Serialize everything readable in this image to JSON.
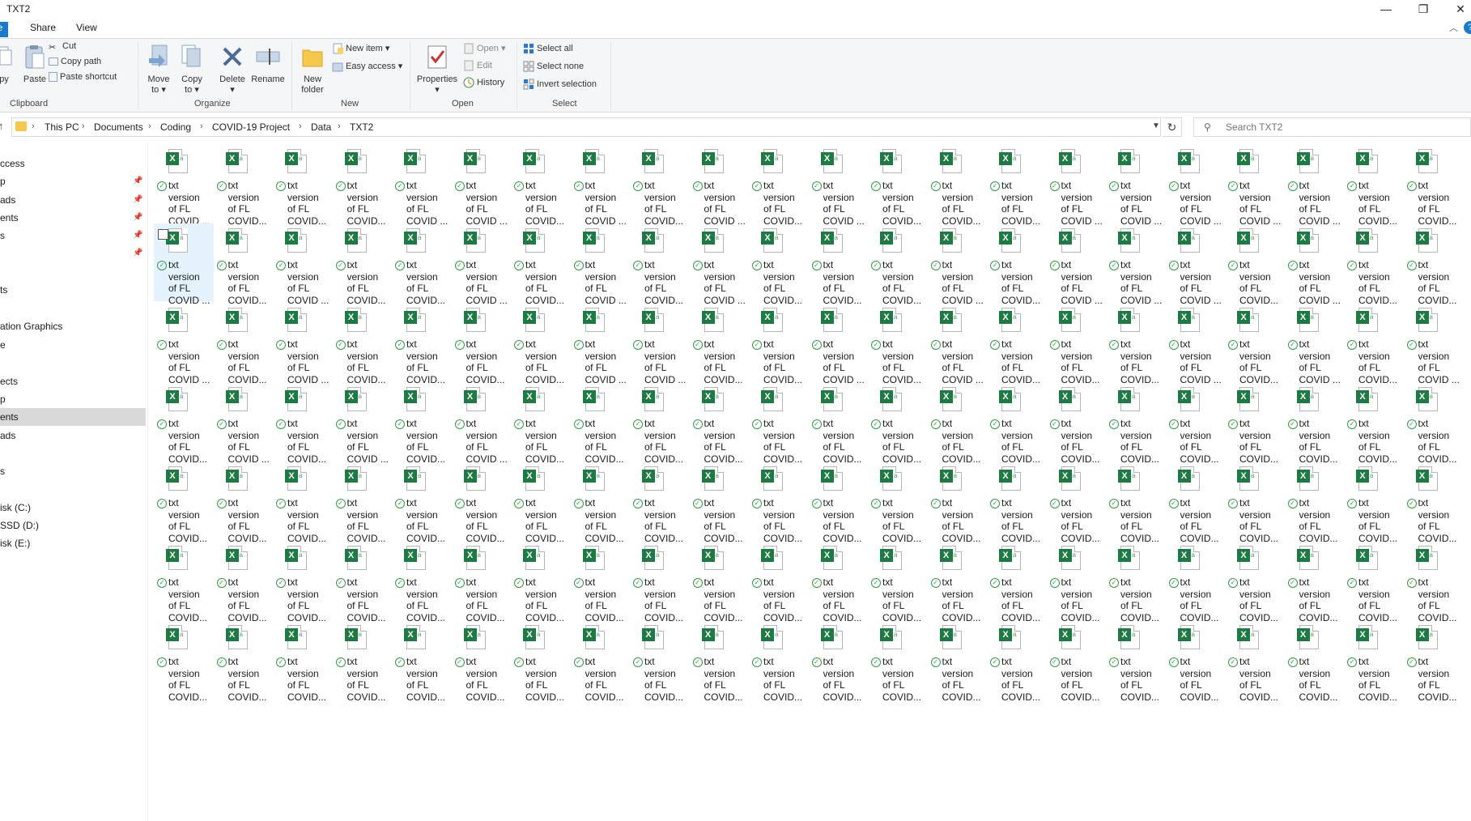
{
  "window": {
    "title": "TXT2",
    "min_glyph": "—",
    "max_glyph": "❐",
    "close_glyph": "✕"
  },
  "menu_tabs": {
    "file": "le",
    "share": "Share",
    "view": "View"
  },
  "ribbon": {
    "groups": {
      "clipboard": "Clipboard",
      "organize": "Organize",
      "new": "New",
      "open": "Open",
      "select": "Select"
    },
    "copy": "py",
    "paste": "Paste",
    "cut": "Cut",
    "copy_path": "Copy path",
    "paste_shortcut": "Paste shortcut",
    "move_to": [
      "Move",
      "to ▾"
    ],
    "copy_to": [
      "Copy",
      "to ▾"
    ],
    "delete": [
      "Delete",
      "▾"
    ],
    "rename": "Rename",
    "new_folder": [
      "New",
      "folder"
    ],
    "new_item": "New item ▾",
    "easy_access": "Easy access ▾",
    "properties": [
      "Properties",
      "▾"
    ],
    "open": "Open ▾",
    "edit": "Edit",
    "history": "History",
    "select_all": "Select all",
    "select_none": "Select none",
    "invert_selection": "Invert selection"
  },
  "address": {
    "crumbs": [
      "This PC",
      "Documents",
      "Coding",
      "COVID-19 Project",
      "Data",
      "TXT2"
    ],
    "sep": "›",
    "search_placeholder": "Search TXT2"
  },
  "nav": {
    "items": [
      {
        "label": "ccess",
        "pinned": false
      },
      {
        "label": "p",
        "pinned": true
      },
      {
        "label": "ads",
        "pinned": true
      },
      {
        "label": "ents",
        "pinned": true
      },
      {
        "label": "s",
        "pinned": true
      },
      {
        "label": "",
        "pinned": true
      },
      {
        "label": "",
        "pinned": false
      },
      {
        "label": "ts",
        "pinned": false
      },
      {
        "label": "",
        "pinned": false
      },
      {
        "label": "ation Graphics",
        "pinned": false
      },
      {
        "label": "e",
        "pinned": false
      },
      {
        "label": "",
        "pinned": false
      },
      {
        "label": "ects",
        "pinned": false
      },
      {
        "label": "p",
        "pinned": false
      },
      {
        "label": "ents",
        "pinned": false,
        "selected": true
      },
      {
        "label": "ads",
        "pinned": false
      },
      {
        "label": "",
        "pinned": false
      },
      {
        "label": "s",
        "pinned": false
      },
      {
        "label": "",
        "pinned": false
      },
      {
        "label": "isk (C:)",
        "pinned": false
      },
      {
        "label": "SSD (D:)",
        "pinned": false
      },
      {
        "label": "isk (E:)",
        "pinned": false
      }
    ],
    "pin_glyph": "📌"
  },
  "files": {
    "count": 154,
    "columns": 22,
    "line1": "txt",
    "line2": "version",
    "line3": "of FL",
    "line4_variants": [
      "COVID...",
      "COVID ..."
    ],
    "line4_pattern": [
      1,
      0,
      0,
      0,
      1,
      1,
      0,
      1,
      0,
      1,
      0,
      1,
      0,
      0,
      0,
      1,
      1,
      1,
      1,
      1,
      0,
      0,
      1,
      0,
      1,
      0,
      0,
      1,
      0,
      1,
      0,
      1,
      0,
      0,
      0,
      1,
      0,
      1,
      1,
      1,
      0,
      1,
      0,
      0,
      1,
      0,
      1,
      0,
      0,
      0,
      0,
      1,
      1,
      0,
      0,
      1,
      0,
      1,
      0,
      0,
      0,
      1,
      0,
      1,
      0,
      1,
      0,
      1,
      0,
      1,
      0,
      1,
      0,
      0,
      0,
      0,
      0,
      0,
      0,
      0,
      0,
      0,
      0,
      0,
      0,
      0,
      0,
      0,
      0,
      0,
      0,
      0,
      0,
      0,
      0,
      0,
      0,
      0,
      0,
      0,
      0,
      0,
      0,
      0,
      0,
      0,
      0,
      0,
      0,
      0,
      0,
      0,
      0,
      0,
      0,
      0,
      0,
      0,
      0,
      0,
      0,
      0,
      0,
      0,
      0,
      0,
      0,
      0,
      0,
      0,
      0,
      0,
      0,
      0,
      0,
      0,
      0,
      0,
      0,
      0,
      0,
      0,
      0,
      0,
      0,
      0,
      0,
      0,
      0,
      0,
      0,
      0,
      0,
      0
    ],
    "icon_letter": "X",
    "icon_sub": "a",
    "sync_glyph": "✓",
    "selected_index": 22
  }
}
